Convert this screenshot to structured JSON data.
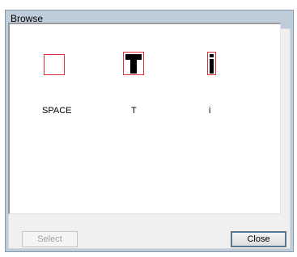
{
  "window": {
    "title": "Browse"
  },
  "glyphs": [
    {
      "name": "SPACE"
    },
    {
      "name": "T"
    },
    {
      "name": "i"
    }
  ],
  "buttons": {
    "select_label": "Select",
    "close_label": "Close"
  },
  "colors": {
    "glyph_border": "#e0303a",
    "title_bar": "#bfcddb"
  }
}
